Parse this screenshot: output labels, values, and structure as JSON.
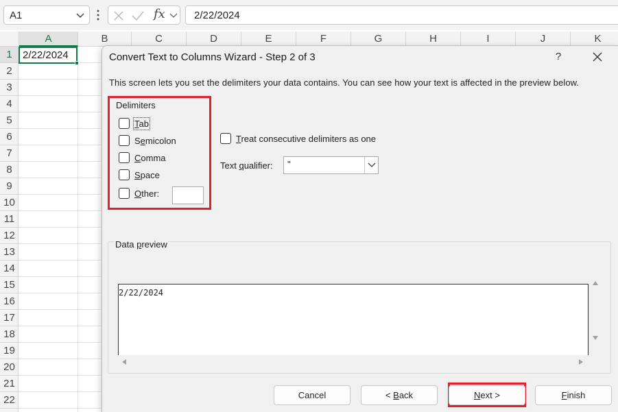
{
  "formula_bar": {
    "name_box": "A1",
    "formula": "2/22/2024",
    "fx_label": "fx"
  },
  "sheet": {
    "columns": [
      "A",
      "B",
      "C",
      "D",
      "E",
      "F",
      "G",
      "H",
      "I",
      "J",
      "K"
    ],
    "rows": [
      "1",
      "2",
      "3",
      "4",
      "5",
      "6",
      "7",
      "8",
      "9",
      "10",
      "11",
      "12",
      "13",
      "14",
      "15",
      "16",
      "17",
      "18",
      "19",
      "20",
      "21",
      "22"
    ],
    "cell_a1": "2/22/2024"
  },
  "dialog": {
    "title": "Convert Text to Columns Wizard - Step 2 of 3",
    "help": "?",
    "description": "This screen lets you set the delimiters your data contains.  You can see how your text is affected in the preview below.",
    "delimiters": {
      "legend": "Delimiters",
      "tab": {
        "pre": "",
        "key": "T",
        "post": "ab",
        "checked": false
      },
      "semicolon": {
        "pre": "S",
        "key": "e",
        "post": "micolon",
        "checked": false
      },
      "comma": {
        "pre": "",
        "key": "C",
        "post": "omma",
        "checked": false
      },
      "space": {
        "pre": "",
        "key": "S",
        "post": "pace",
        "checked": false
      },
      "other": {
        "pre": "",
        "key": "O",
        "post": "ther:",
        "checked": false,
        "value": ""
      }
    },
    "consecutive": {
      "pre": "",
      "key": "T",
      "post": "reat consecutive delimiters as one",
      "checked": false
    },
    "text_qualifier": {
      "pre": "Text ",
      "key": "q",
      "post": "ualifier:",
      "value": "\""
    },
    "data_preview": {
      "legend_pre": "Data ",
      "legend_key": "p",
      "legend_post": "review",
      "lines": [
        "2/22/2024"
      ]
    },
    "buttons": {
      "cancel": "Cancel",
      "back_pre": "< ",
      "back_key": "B",
      "back_post": "ack",
      "next_pre": "",
      "next_key": "N",
      "next_post": "ext >",
      "finish_pre": "",
      "finish_key": "F",
      "finish_post": "inish"
    }
  },
  "colors": {
    "highlight": "#e0202c",
    "excel_green": "#107c41"
  }
}
